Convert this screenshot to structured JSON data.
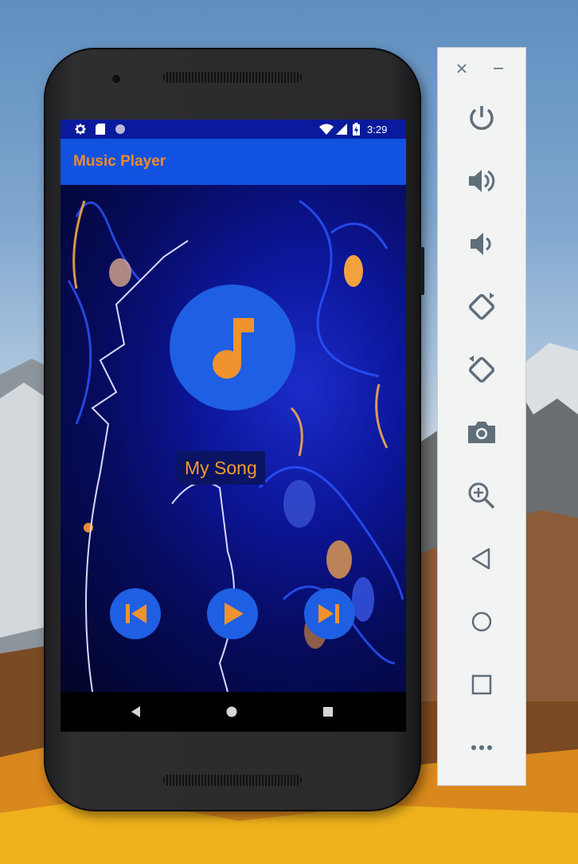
{
  "status_bar": {
    "time": "3:29",
    "left_icons": [
      "settings-icon",
      "sd-card-icon",
      "circle-notification-icon"
    ],
    "right_icons": [
      "wifi-icon",
      "signal-icon",
      "battery-icon"
    ]
  },
  "app_bar": {
    "title": "Music Player",
    "background_color": "#1252e0",
    "title_color": "#f08b2a"
  },
  "player": {
    "artwork_icon": "music-note-icon",
    "song_title": "My Song",
    "controls": [
      {
        "name": "previous",
        "icon": "skip-previous-icon"
      },
      {
        "name": "play",
        "icon": "play-icon"
      },
      {
        "name": "next",
        "icon": "skip-next-icon"
      }
    ],
    "accent_color": "#f39a2e",
    "button_color": "#1f5fe3"
  },
  "nav_bar": {
    "buttons": [
      "back-icon",
      "home-icon",
      "recents-icon"
    ]
  },
  "emulator_panel": {
    "window_controls": [
      "close-icon",
      "minimize-icon"
    ],
    "tools": [
      "power-icon",
      "volume-up-icon",
      "volume-down-icon",
      "rotate-left-icon",
      "rotate-right-icon",
      "camera-icon",
      "zoom-icon",
      "back-icon",
      "home-icon",
      "overview-icon",
      "more-icon"
    ],
    "icon_color": "#5f6f7a"
  }
}
